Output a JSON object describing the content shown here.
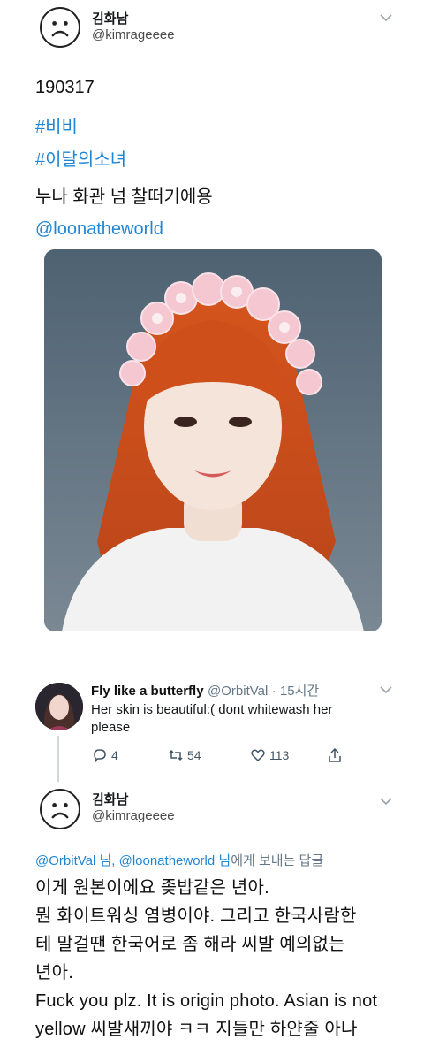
{
  "tweet": {
    "author_name": "김화남",
    "author_handle": "@kimrageeee",
    "date_line": "190317",
    "hashtags": [
      "#비비",
      "#이달의소녀"
    ],
    "text": "누나 화관 넘 찰떠기에용",
    "mention": "@loonatheworld"
  },
  "reply": {
    "author_name": "Fly like a butterfly",
    "author_handle": "@OrbitVal",
    "time": "· 15시간",
    "text": "Her skin is beautiful:( dont whitewash her please",
    "replies": "4",
    "retweets": "54",
    "likes": "113"
  },
  "reply2": {
    "author_name": "김화남",
    "author_handle": "@kimrageeee",
    "to_mentions": "@OrbitVal 님, @loonatheworld 님",
    "to_suffix": "에게 보내는 답글",
    "lines": [
      "이게 원본이에요 좆밥같은 년아.",
      "뭔 화이트워싱 염병이야. 그리고 한국사람한",
      "테 말걸땐 한국어로 좀 해라 씨발 예의없는",
      "년아.",
      "Fuck you plz. It is origin photo. Asian is not",
      "yellow  씨발새끼야 ㅋㅋ 지들만 하얀줄 아나"
    ]
  },
  "icons": {
    "menu": "chevron-down-icon",
    "reply": "reply-icon",
    "retweet": "retweet-icon",
    "like": "heart-icon",
    "share": "share-icon"
  },
  "colors": {
    "link": "#1f86d6",
    "muted": "#657786",
    "photo_bg": "#5f7180"
  }
}
